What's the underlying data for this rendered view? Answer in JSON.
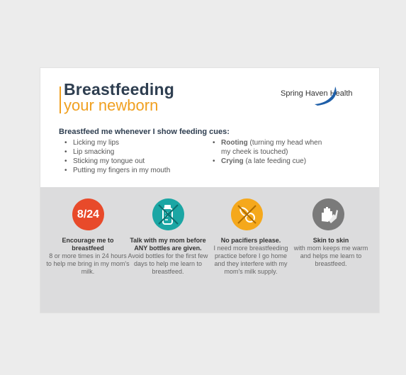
{
  "header": {
    "title_line1": "Breastfeeding",
    "title_line2": "your newborn",
    "brand": "Spring Haven Health",
    "colors": {
      "navy": "#2e3e50",
      "orange": "#f0a020",
      "swoosh": "#1f5fa8"
    }
  },
  "cues": {
    "heading": "Breastfeed me whenever I show feeding cues:",
    "left": [
      "Licking my lips",
      "Lip smacking",
      "Sticking my tongue out",
      "Putting my fingers in my mouth"
    ],
    "right": [
      {
        "bold": "Rooting",
        "rest": " (turning my head when",
        "rest2": "my cheek is touched)"
      },
      {
        "bold": "Crying",
        "rest": " (a late feeding cue)"
      }
    ]
  },
  "tips": [
    {
      "icon": "calendar-8-24-icon",
      "badge": "8/24",
      "color": "#e84a2a",
      "bold": "Encourage me to breastfeed",
      "text": "8 or more times in 24 hours to help me bring in my mom's milk."
    },
    {
      "icon": "no-bottle-icon",
      "color": "#1ba6a4",
      "bold": "Talk with my mom before ANY bottles are given.",
      "text": "Avoid bottles for the first few days to help me learn to breastfeed."
    },
    {
      "icon": "no-pacifier-icon",
      "color": "#f5a81c",
      "bold": "No pacifiers please.",
      "text": "I need more breastfeeding practice before I go home and they interfere with my mom's milk supply."
    },
    {
      "icon": "hands-icon",
      "color": "#7a7a7a",
      "bold": "Skin to skin",
      "text": "with mom keeps me warm and helps me learn to breastfeed."
    }
  ]
}
